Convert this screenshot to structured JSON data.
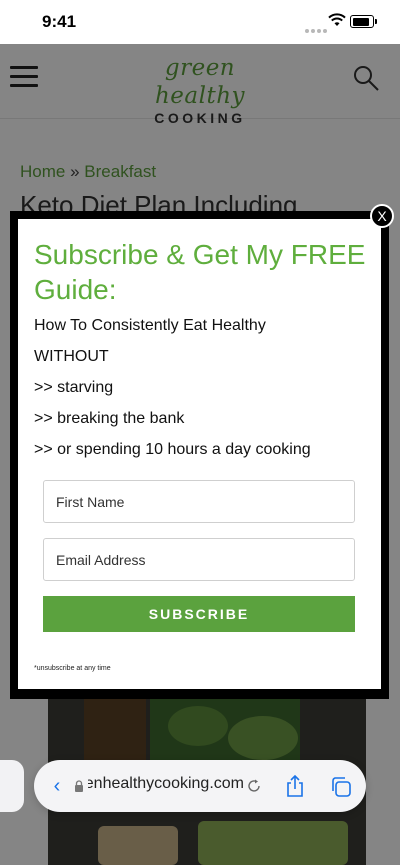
{
  "status_bar": {
    "time": "9:41"
  },
  "site": {
    "logo_script": "green healthy",
    "logo_word": "COOKING",
    "breadcrumb": {
      "home": "Home",
      "separator": "»",
      "category": "Breakfast"
    },
    "article_title": "Keto Diet Plan Including"
  },
  "modal": {
    "close_label": "X",
    "headline": "Subscribe & Get My FREE Guide:",
    "lines": [
      "How To Consistently Eat Healthy",
      "WITHOUT",
      ">> starving",
      ">> breaking the bank",
      ">> or spending 10 hours a day cooking"
    ],
    "first_name_placeholder": "First Name",
    "email_placeholder": "Email Address",
    "subscribe_label": "SUBSCRIBE",
    "fineprint": "*unsubscribe at any time"
  },
  "browser": {
    "url": "greenhealthycooking.com",
    "accent_color": "#1a73e8"
  },
  "icons": [
    "hamburger-icon",
    "search-icon",
    "close-icon",
    "back-icon",
    "lock-icon",
    "reload-icon",
    "share-icon",
    "tabs-icon"
  ],
  "colors": {
    "brand_green": "#5fae3d",
    "button_green": "#5ba23e"
  }
}
